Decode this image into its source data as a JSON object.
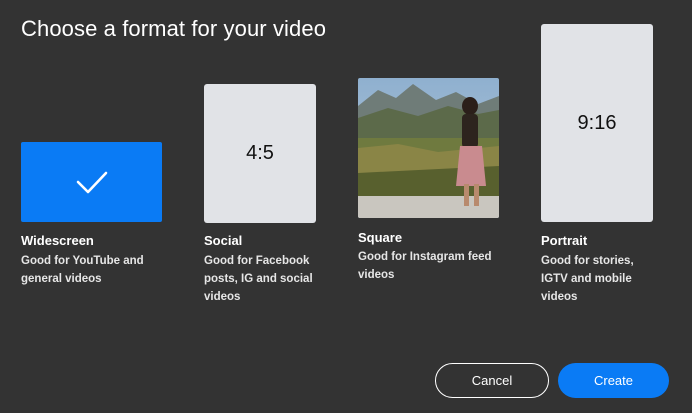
{
  "dialog": {
    "title": "Choose a format for your video"
  },
  "formats": [
    {
      "name": "Widescreen",
      "ratio": "",
      "description": "Good for YouTube and general videos",
      "selected": true
    },
    {
      "name": "Social",
      "ratio": "4:5",
      "description": "Good for Facebook posts, IG and social videos",
      "selected": false
    },
    {
      "name": "Square",
      "ratio": "",
      "description": "Good for Instagram feed videos",
      "selected": false
    },
    {
      "name": "Portrait",
      "ratio": "9:16",
      "description": "Good for stories, IGTV and mobile videos",
      "selected": false
    }
  ],
  "actions": {
    "cancel_label": "Cancel",
    "create_label": "Create"
  },
  "colors": {
    "background": "#333333",
    "accent": "#0a7bf5",
    "thumbnail": "#e1e3e7"
  },
  "icons": {
    "selected": "checkmark-icon"
  }
}
